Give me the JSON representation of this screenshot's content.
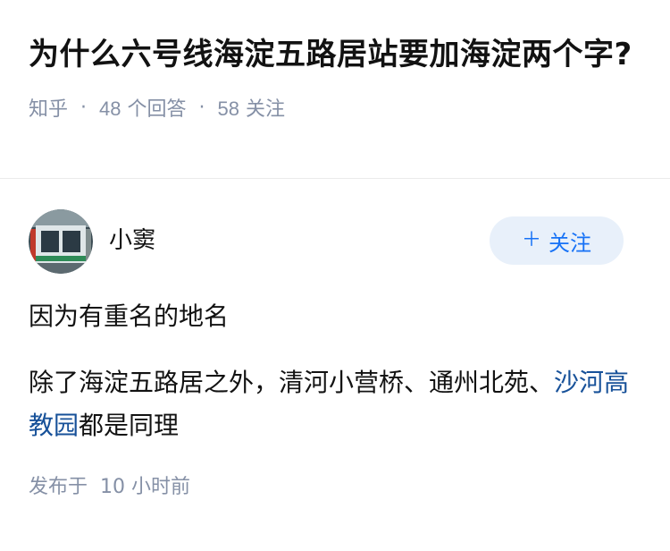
{
  "question": {
    "title": "为什么六号线海淀五路居站要加海淀两个字?",
    "source": "知乎",
    "answers_count": "48",
    "answers_label": "个回答",
    "followers_count": "58",
    "followers_label": "关注"
  },
  "answer": {
    "author_name": "小窦",
    "follow_label": "关注",
    "paragraph1": "因为有重名的地名",
    "paragraph2_text": "除了海淀五路居之外，清河小营桥、通州北苑、",
    "paragraph2_link": "沙河高教园",
    "paragraph2_tail": "都是同理",
    "publish_time": "发布于  10 小时前"
  },
  "colors": {
    "accent": "#1772f6",
    "link": "#175199",
    "meta": "#8590a6",
    "follow_bg": "#e8f0fa"
  }
}
